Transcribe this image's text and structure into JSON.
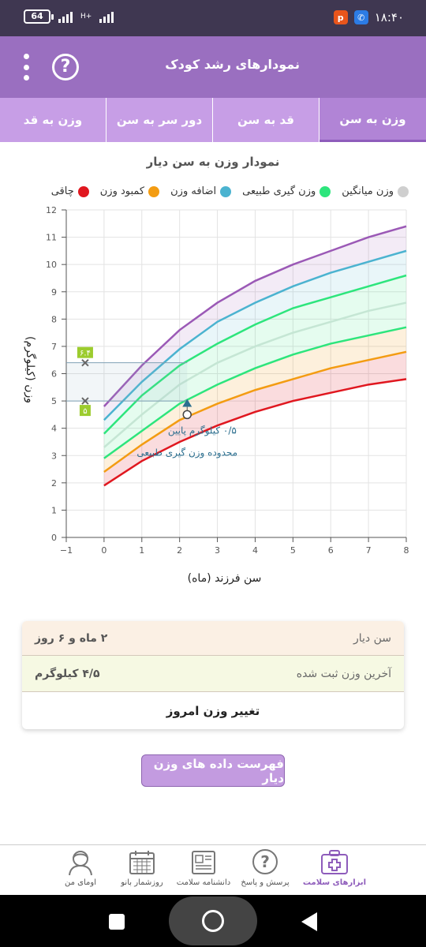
{
  "status_bar": {
    "battery": "64",
    "network": "H+",
    "time": "۱۸:۴۰"
  },
  "app_bar": {
    "title": "نمودارهای رشد کودک",
    "help_label": "?"
  },
  "tabs": [
    {
      "label": "وزن به سن",
      "active": true
    },
    {
      "label": "قد به سن",
      "active": false
    },
    {
      "label": "دور سر به سن",
      "active": false
    },
    {
      "label": "وزن به قد",
      "active": false
    }
  ],
  "chart_title": "نمودار وزن به سن دیار",
  "legend": [
    {
      "label": "چاقی",
      "color": "#e0171f"
    },
    {
      "label": "کمبود وزن",
      "color": "#f39c12"
    },
    {
      "label": "اضافه وزن",
      "color": "#4bb3d0"
    },
    {
      "label": "وزن گیری طبیعی",
      "color": "#2de57c"
    },
    {
      "label": "وزن میانگین",
      "color": "#cfcfcf"
    }
  ],
  "chart_data": {
    "type": "line",
    "ylabel": "وزن (کیلوگرم)",
    "xlabel": "سن فرزند (ماه)",
    "xlim": [
      -1,
      8
    ],
    "ylim": [
      0,
      12
    ],
    "x_ticks": [
      "−1",
      "0",
      "1",
      "2",
      "3",
      "4",
      "5",
      "6",
      "7",
      "8"
    ],
    "y_ticks": [
      "0",
      "1",
      "2",
      "3",
      "4",
      "5",
      "6",
      "7",
      "8",
      "9",
      "10",
      "11",
      "12"
    ],
    "x": [
      0,
      1,
      2,
      3,
      4,
      5,
      6,
      7,
      8
    ],
    "series": [
      {
        "values": [
          4.8,
          6.3,
          7.6,
          8.6,
          9.4,
          10.0,
          10.5,
          11.0,
          11.4
        ],
        "color": "#9b59b6"
      },
      {
        "values": [
          4.3,
          5.7,
          6.9,
          7.9,
          8.6,
          9.2,
          9.7,
          10.1,
          10.5
        ],
        "color": "#4bb3d0"
      },
      {
        "values": [
          3.8,
          5.2,
          6.3,
          7.1,
          7.8,
          8.4,
          8.8,
          9.2,
          9.6
        ],
        "color": "#2de57c"
      },
      {
        "values": [
          3.3,
          4.5,
          5.6,
          6.4,
          7.0,
          7.5,
          7.9,
          8.3,
          8.6
        ],
        "color": "#c5e6d4"
      },
      {
        "values": [
          2.9,
          3.9,
          4.9,
          5.6,
          6.2,
          6.7,
          7.1,
          7.4,
          7.7
        ],
        "color": "#2de57c"
      },
      {
        "values": [
          2.4,
          3.4,
          4.3,
          4.9,
          5.4,
          5.8,
          6.2,
          6.5,
          6.8
        ],
        "color": "#f39c12"
      },
      {
        "values": [
          1.9,
          2.8,
          3.5,
          4.1,
          4.6,
          5.0,
          5.3,
          5.6,
          5.8
        ],
        "color": "#e0171f"
      }
    ],
    "points": [
      {
        "x": 2.2,
        "y": 4.9,
        "shape": "triangle"
      },
      {
        "x": 2.2,
        "y": 4.5,
        "shape": "circle"
      }
    ],
    "y_markers": [
      {
        "value": 6.4,
        "label": "۶.۴"
      },
      {
        "value": 5.0,
        "label": "۵"
      }
    ],
    "annotation": {
      "line1": "۰/۵ کیلوگرم پایین",
      "line2": "محدوده وزن گیری طبیعی"
    }
  },
  "info_card": {
    "age_label": "سن دیار",
    "age_value": "۲ ماه و ۶ روز",
    "weight_label": "آخرین وزن ثبت شده",
    "weight_value": "۴/۵ کیلوگرم",
    "change_label": "تغییر وزن امروز"
  },
  "list_button": "فهرست داده های وزن دیار",
  "bottom_nav": [
    {
      "label": "ابزارهای سلامت",
      "icon": "health-tools-icon",
      "active": true
    },
    {
      "label": "پرسش و پاسخ",
      "icon": "question-icon",
      "active": false
    },
    {
      "label": "دانشنامه سلامت",
      "icon": "encyclopedia-icon",
      "active": false
    },
    {
      "label": "روزشمار بانو",
      "icon": "calendar-icon",
      "active": false
    },
    {
      "label": "اومای من",
      "icon": "profile-icon",
      "active": false
    }
  ]
}
